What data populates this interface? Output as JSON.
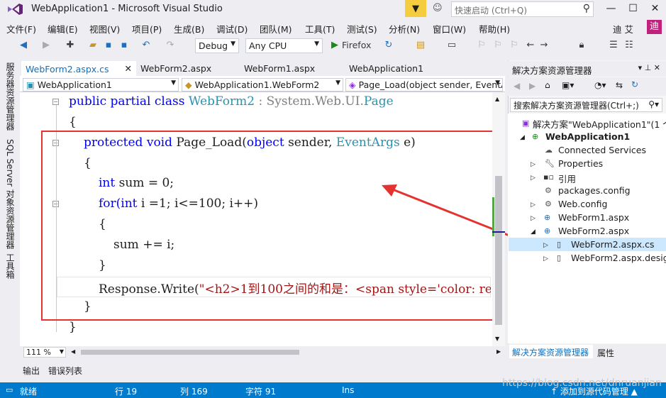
{
  "window": {
    "title": "WebApplication1 - Microsoft Visual Studio",
    "quick_launch_placeholder": "快速启动 (Ctrl+Q)",
    "user": "迪 艾",
    "avatar": "迪"
  },
  "menu": [
    "文件(F)",
    "编辑(E)",
    "视图(V)",
    "项目(P)",
    "生成(B)",
    "调试(D)",
    "团队(M)",
    "工具(T)",
    "测试(S)",
    "分析(N)",
    "窗口(W)",
    "帮助(H)"
  ],
  "toolbar": {
    "config": "Debug",
    "platform": "Any CPU",
    "run_target": "Firefox"
  },
  "side_tabs": [
    "服务器资源管理器",
    "SQL Server 对象资源管理器",
    "工具箱"
  ],
  "doc_tabs": [
    "WebForm2.aspx.cs",
    "WebForm2.aspx",
    "WebForm1.aspx",
    "WebApplication1"
  ],
  "nav": {
    "project": "WebApplication1",
    "class": "WebApplication1.WebForm2",
    "member": "Page_Load(object sender, EventArgs e)"
  },
  "code": {
    "l1_kw": "public partial class",
    "l1_type": "WebForm2",
    "l1_colon": ":",
    "l1_base_ns": "System.Web.UI.",
    "l1_base": "Page",
    "l2": "{",
    "l3_kw": "protected void",
    "l3_name": "Page_Load(",
    "l3_obj": "object",
    "l3_sender": "sender,",
    "l3_eargs": "EventArgs",
    "l3_e": "e)",
    "l4": "{",
    "l5_kw": "int",
    "l5_rest": "sum = 0;",
    "l6_kw": "for(",
    "l6_int": "int",
    "l6_rest": "i =1; i<=100; i++)",
    "l7": "{",
    "l8": "sum += i;",
    "l9": "}",
    "l10_call": "Response.Write(",
    "l10_str": "\"<h2>1到100之间的和是：<span style='color: re",
    "l11": "}",
    "l12": "}"
  },
  "zoom": "111 %",
  "bottom_tabs": [
    "输出",
    "错误列表"
  ],
  "status": {
    "ready": "就绪",
    "line": "行 19",
    "col": "列 169",
    "char": "字符 91",
    "mode": "Ins",
    "source_control": "↑ 添加到源代码管理 ▲"
  },
  "solution_explorer": {
    "title": "解决方案资源管理器",
    "search": "搜索解决方案资源管理器(Ctrl+;)",
    "items": [
      "解决方案\"WebApplication1\"(1 个",
      "WebApplication1",
      "Connected Services",
      "Properties",
      "引用",
      "packages.config",
      "Web.config",
      "WebForm1.aspx",
      "WebForm2.aspx",
      "WebForm2.aspx.cs",
      "WebForm2.aspx.desig"
    ],
    "bottom_tabs": [
      "解决方案资源管理器",
      "属性"
    ]
  },
  "watermark": "https://blog.csdn.net/dnruanjian",
  "colors": {
    "accent": "#007acc",
    "keyword": "#0000ff",
    "type": "#2b91af",
    "string": "#a31515",
    "highlight": "#e5322e"
  }
}
